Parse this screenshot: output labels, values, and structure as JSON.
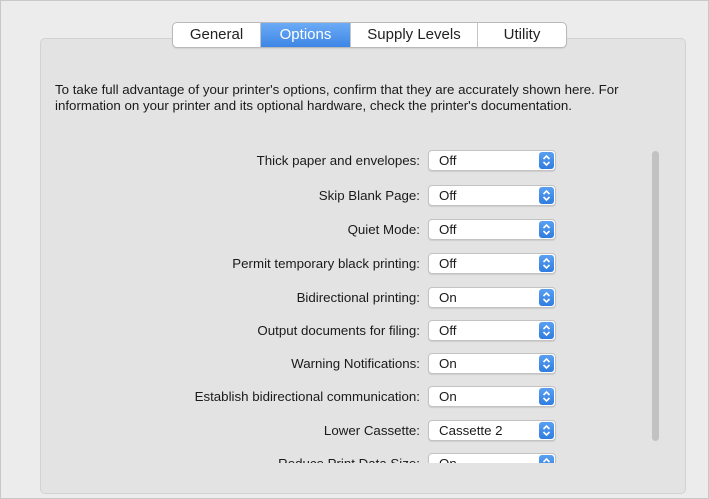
{
  "tabs": [
    "General",
    "Options",
    "Supply Levels",
    "Utility"
  ],
  "active_tab": "Options",
  "intro_text": "To take full advantage of your printer's options, confirm that they are accurately shown here. For information on your printer and its optional hardware, check the printer's documentation.",
  "options": [
    {
      "label": "Thick paper and envelopes:",
      "value": "Off"
    },
    {
      "label": "Skip Blank Page:",
      "value": "Off"
    },
    {
      "label": "Quiet Mode:",
      "value": "Off"
    },
    {
      "label": "Permit temporary black printing:",
      "value": "Off"
    },
    {
      "label": "Bidirectional printing:",
      "value": "On"
    },
    {
      "label": "Output documents for filing:",
      "value": "Off"
    },
    {
      "label": "Warning Notifications:",
      "value": "On"
    },
    {
      "label": "Establish bidirectional communication:",
      "value": "On"
    },
    {
      "label": "Lower Cassette:",
      "value": "Cassette 2"
    },
    {
      "label": "Reduce Print Data Size:",
      "value": "On"
    }
  ],
  "colors": {
    "accent": "#3d86e6"
  },
  "icons": {
    "popup_arrows": "up-down-chevron-icon"
  }
}
